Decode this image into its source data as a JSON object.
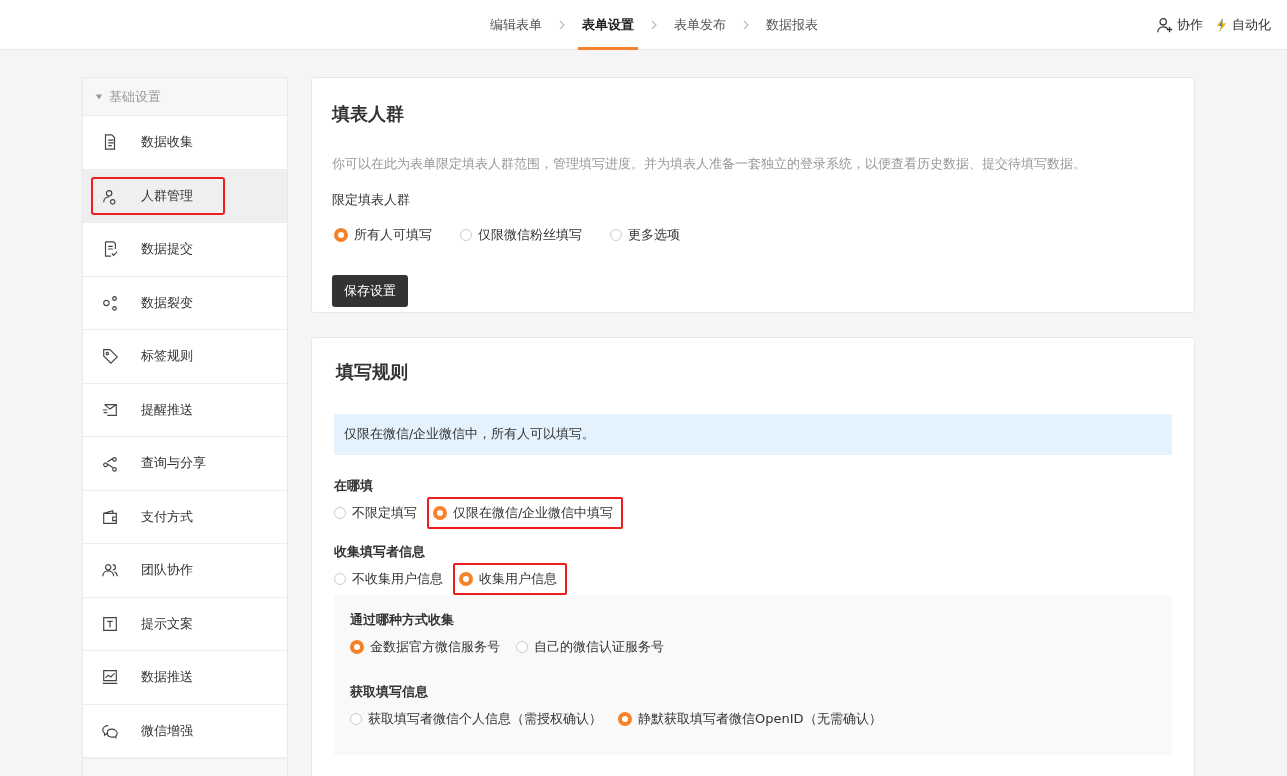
{
  "top_nav": {
    "steps": [
      {
        "label": "编辑表单",
        "selected": false
      },
      {
        "label": "表单设置",
        "selected": true
      },
      {
        "label": "表单发布",
        "selected": false
      },
      {
        "label": "数据报表",
        "selected": false
      }
    ],
    "actions": [
      "协作",
      "自动化"
    ]
  },
  "sidebar": {
    "section": "基础设置",
    "items": [
      {
        "label": "数据收集",
        "selected": false,
        "highlighted": false
      },
      {
        "label": "人群管理",
        "selected": true,
        "highlighted": true
      },
      {
        "label": "数据提交",
        "selected": false,
        "highlighted": false
      },
      {
        "label": "数据裂变",
        "selected": false,
        "highlighted": false
      },
      {
        "label": "标签规则",
        "selected": false,
        "highlighted": false
      },
      {
        "label": "提醒推送",
        "selected": false,
        "highlighted": false
      },
      {
        "label": "查询与分享",
        "selected": false,
        "highlighted": false
      },
      {
        "label": "支付方式",
        "selected": false,
        "highlighted": false
      },
      {
        "label": "团队协作",
        "selected": false,
        "highlighted": false
      },
      {
        "label": "提示文案",
        "selected": false,
        "highlighted": false
      },
      {
        "label": "数据推送",
        "selected": false,
        "highlighted": false
      },
      {
        "label": "微信增强",
        "selected": false,
        "highlighted": false
      }
    ]
  },
  "audience_card": {
    "title": "填表人群",
    "description": "你可以在此为表单限定填表人群范围，管理填写进度。并为填表人准备一套独立的登录系统，以便查看历史数据、提交待填写数据。",
    "field_label": "限定填表人群",
    "options": [
      {
        "label": "所有人可填写",
        "selected": true
      },
      {
        "label": "仅限微信粉丝填写",
        "selected": false
      },
      {
        "label": "更多选项",
        "selected": false
      }
    ],
    "save_button": "保存设置"
  },
  "rules_card": {
    "title": "填写规则",
    "notice": "仅限在微信/企业微信中，所有人可以填写。",
    "where": {
      "label": "在哪填",
      "options": [
        {
          "label": "不限定填写",
          "selected": false,
          "highlighted": false
        },
        {
          "label": "仅限在微信/企业微信中填写",
          "selected": true,
          "highlighted": true
        }
      ]
    },
    "collect": {
      "label": "收集填写者信息",
      "options": [
        {
          "label": "不收集用户信息",
          "selected": false,
          "highlighted": false
        },
        {
          "label": "收集用户信息",
          "selected": true,
          "highlighted": true
        }
      ]
    },
    "method": {
      "label": "通过哪种方式收集",
      "options": [
        {
          "label": "金数据官方微信服务号",
          "selected": true,
          "highlighted": false
        },
        {
          "label": "自己的微信认证服务号",
          "selected": false,
          "highlighted": false
        }
      ]
    },
    "fetch": {
      "label": "获取填写信息",
      "options": [
        {
          "label": "获取填写者微信个人信息（需授权确认）",
          "selected": false,
          "highlighted": false
        },
        {
          "label": "静默获取填写者微信OpenID（无需确认）",
          "selected": true,
          "highlighted": false
        }
      ]
    }
  }
}
